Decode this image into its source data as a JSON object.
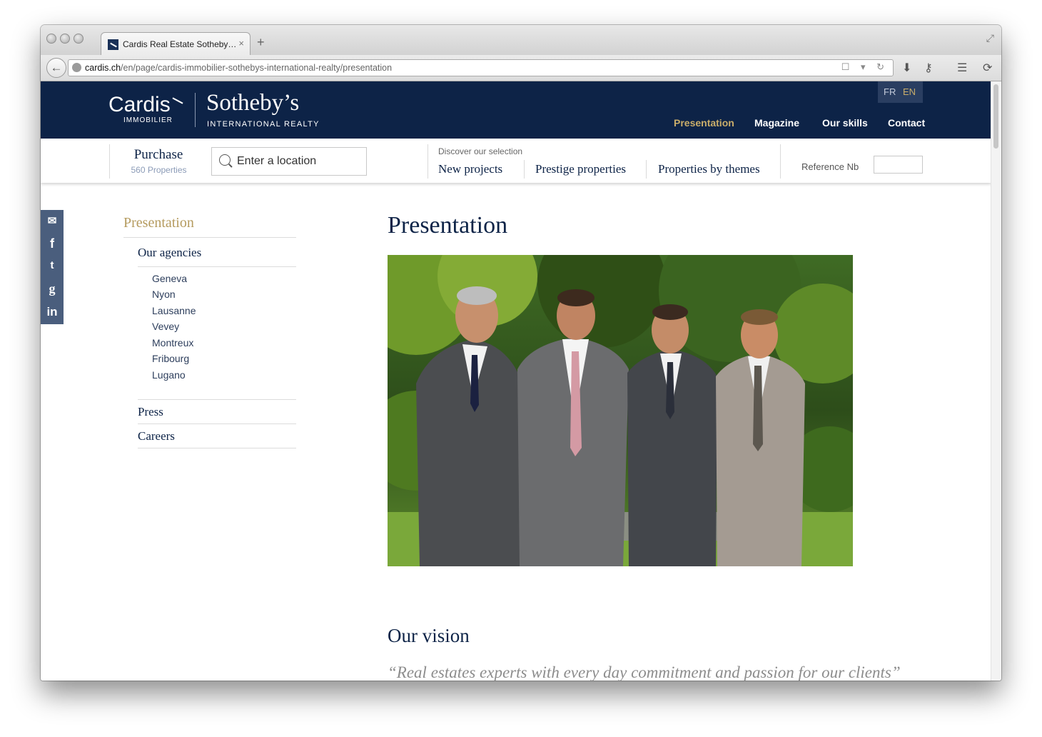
{
  "browser": {
    "tab_title": "Cardis Real Estate Sotheby…",
    "url_domain": "cardis.ch",
    "url_path": "/en/page/cardis-immobilier-sothebys-international-realty/presentation"
  },
  "header": {
    "brand1": "Cardis",
    "brand1_sub": "IMMOBILIER",
    "brand2": "Sotheby’s",
    "brand2_sub": "INTERNATIONAL REALTY",
    "lang_fr": "FR",
    "lang_en": "EN",
    "nav": [
      "Presentation",
      "Magazine",
      "Our skills",
      "Contact"
    ],
    "accent_color": "#c9ad6a",
    "navy_color": "#0d2347"
  },
  "search": {
    "purchase_label": "Purchase",
    "purchase_count": "560 Properties",
    "location_placeholder": "Enter a location",
    "discover_label": "Discover our selection",
    "selections": [
      "New projects",
      "Prestige properties",
      "Properties by themes"
    ],
    "reference_label": "Reference Nb"
  },
  "social": [
    "mail-icon",
    "facebook-icon",
    "twitter-icon",
    "google-plus-icon",
    "linkedin-icon"
  ],
  "sidebar": {
    "title": "Presentation",
    "agencies_label": "Our agencies",
    "agencies": [
      "Geneva",
      "Nyon",
      "Lausanne",
      "Vevey",
      "Montreux",
      "Fribourg",
      "Lugano"
    ],
    "press_label": "Press",
    "careers_label": "Careers"
  },
  "content": {
    "title": "Presentation",
    "vision_title": "Our vision",
    "quote": "“Real estates experts with every day commitment and passion for our clients”"
  }
}
